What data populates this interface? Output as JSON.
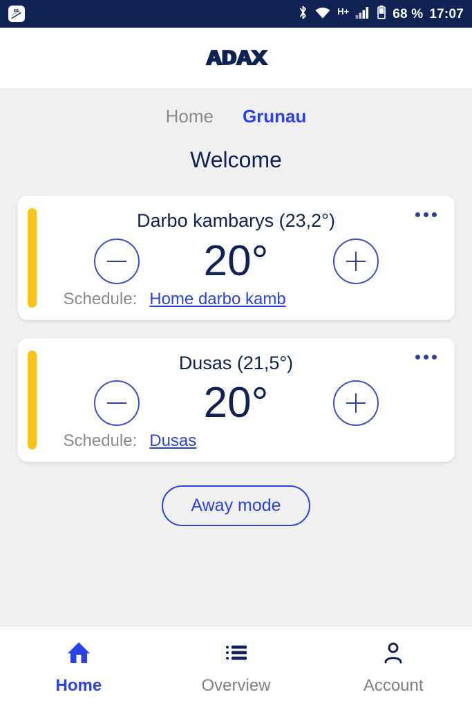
{
  "statusbar": {
    "app_icon": "notification-app-icon",
    "bluetooth_icon": "bluetooth-icon",
    "wifi_icon": "wifi-icon",
    "network_type": "H+",
    "signal_icon": "signal-bars-icon",
    "battery_icon": "battery-icon",
    "battery": "68 %",
    "time": "17:07",
    "background": "#102154"
  },
  "header": {
    "logo_text": "ADAX"
  },
  "tabs": [
    {
      "label": "Home",
      "active": false
    },
    {
      "label": "Grunau",
      "active": true
    }
  ],
  "page_title": "Welcome",
  "colors": {
    "accent_yellow": "#fbc319",
    "brand_navy": "#102154",
    "link_blue": "#2a41e8",
    "muted_gray": "#8a8a8a",
    "page_background": "#f0f0f0"
  },
  "rooms": [
    {
      "title": "Darbo kambarys (23,2°)",
      "current_temp": "23,2°",
      "target_temp": "20°",
      "decrease_label": "minus-icon",
      "increase_label": "plus-icon",
      "menu_label": "more-options",
      "schedule_label": "Schedule:",
      "schedule_name": "Home darbo kamb"
    },
    {
      "title": "Dusas (21,5°)",
      "current_temp": "21,5°",
      "target_temp": "20°",
      "decrease_label": "minus-icon",
      "increase_label": "plus-icon",
      "menu_label": "more-options",
      "schedule_label": "Schedule:",
      "schedule_name": "Dusas"
    }
  ],
  "away_button": "Away mode",
  "bottomnav": [
    {
      "label": "Home",
      "icon": "home-icon",
      "active": true
    },
    {
      "label": "Overview",
      "icon": "list-icon",
      "active": false
    },
    {
      "label": "Account",
      "icon": "person-icon",
      "active": false
    }
  ]
}
